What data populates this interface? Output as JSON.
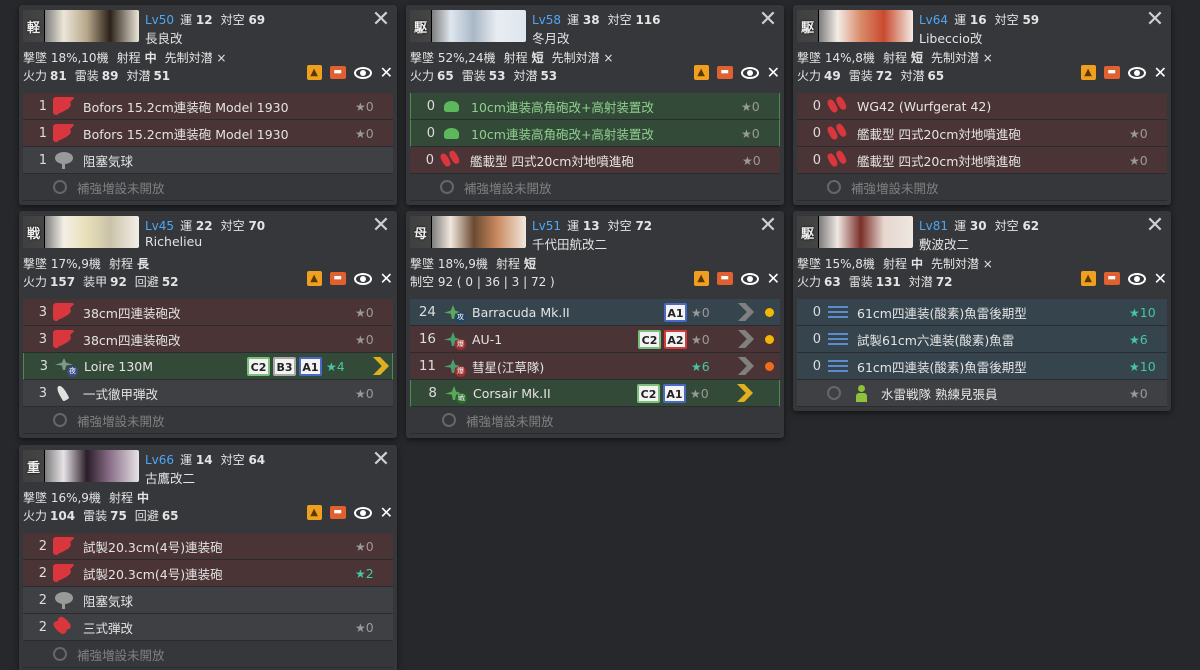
{
  "ships": [
    {
      "type_char": "軽",
      "level": "Lv50",
      "luck_label": "運",
      "luck": "12",
      "aa_label": "対空",
      "aa": "69",
      "name": "長良改",
      "shootdown": "撃墜 18%,10機",
      "range_label": "射程",
      "range": "中",
      "extra": "先制対潜 ×",
      "stats": [
        {
          "label": "火力",
          "value": "81"
        },
        {
          "label": "雷装",
          "value": "89"
        },
        {
          "label": "対潜",
          "value": "51"
        }
      ],
      "banner_colors": [
        "#ece6d8",
        "#b7a78a",
        "#2b2118"
      ],
      "equipment": [
        {
          "slot": "1",
          "icon": "gun-red",
          "name": "Bofors 15.2cm連装砲 Model 1930",
          "star": "0",
          "bg": "red"
        },
        {
          "slot": "1",
          "icon": "gun-red",
          "name": "Bofors 15.2cm連装砲 Model 1930",
          "star": "0",
          "bg": "red"
        },
        {
          "slot": "1",
          "icon": "balloon-gray",
          "name": "阻塞気球",
          "star": "",
          "bg": "gray"
        },
        {
          "slot": "",
          "icon": "slot-locked",
          "name": "補強増設未開放",
          "star": "",
          "bg": "none"
        }
      ]
    },
    {
      "type_char": "駆",
      "level": "Lv58",
      "luck_label": "運",
      "luck": "38",
      "aa_label": "対空",
      "aa": "116",
      "name": "冬月改",
      "shootdown": "撃墜 52%,24機",
      "range_label": "射程",
      "range": "短",
      "extra": "先制対潜 ×",
      "stats": [
        {
          "label": "火力",
          "value": "65"
        },
        {
          "label": "雷装",
          "value": "53"
        },
        {
          "label": "対潜",
          "value": "53"
        }
      ],
      "banner_colors": [
        "#dfe6ee",
        "#a9b7c6",
        "#e9edf2"
      ],
      "equipment": [
        {
          "slot": "0",
          "icon": "gun-green",
          "name": "10cm連装高角砲改+高射装置改",
          "star": "0",
          "bg": "green"
        },
        {
          "slot": "0",
          "icon": "gun-green",
          "name": "10cm連装高角砲改+高射装置改",
          "star": "0",
          "bg": "green"
        },
        {
          "slot": "0",
          "icon": "rocket-red",
          "name": "艦載型 四式20cm対地噴進砲",
          "star": "0",
          "bg": "red"
        },
        {
          "slot": "",
          "icon": "slot-locked",
          "name": "補強増設未開放",
          "star": "",
          "bg": "none"
        }
      ]
    },
    {
      "type_char": "駆",
      "level": "Lv64",
      "luck_label": "運",
      "luck": "16",
      "aa_label": "対空",
      "aa": "59",
      "name": "Libeccio改",
      "shootdown": "撃墜 14%,8機",
      "range_label": "射程",
      "range": "短",
      "extra": "先制対潜 ×",
      "stats": [
        {
          "label": "火力",
          "value": "49"
        },
        {
          "label": "雷装",
          "value": "72"
        },
        {
          "label": "対潜",
          "value": "65"
        }
      ],
      "banner_colors": [
        "#f3ece6",
        "#d98a6a",
        "#c94a2e"
      ],
      "equipment": [
        {
          "slot": "0",
          "icon": "rocket-red",
          "name": "WG42 (Wurfgerat 42)",
          "star": "",
          "bg": "red"
        },
        {
          "slot": "0",
          "icon": "rocket-red",
          "name": "艦載型 四式20cm対地噴進砲",
          "star": "0",
          "bg": "red"
        },
        {
          "slot": "0",
          "icon": "rocket-red",
          "name": "艦載型 四式20cm対地噴進砲",
          "star": "0",
          "bg": "red"
        },
        {
          "slot": "",
          "icon": "slot-locked",
          "name": "補強増設未開放",
          "star": "",
          "bg": "none"
        }
      ]
    },
    {
      "type_char": "戦",
      "level": "Lv45",
      "luck_label": "運",
      "luck": "22",
      "aa_label": "対空",
      "aa": "70",
      "name": "Richelieu",
      "shootdown": "撃墜 17%,9機",
      "range_label": "射程",
      "range": "長",
      "extra": "",
      "stats": [
        {
          "label": "火力",
          "value": "157"
        },
        {
          "label": "装甲",
          "value": "92"
        },
        {
          "label": "回避",
          "value": "52"
        }
      ],
      "banner_colors": [
        "#f3efe6",
        "#e8dfb8",
        "#c9c2a9"
      ],
      "equipment": [
        {
          "slot": "3",
          "icon": "gun-red",
          "name": "38cm四連装砲改",
          "star": "0",
          "bg": "red"
        },
        {
          "slot": "3",
          "icon": "gun-red",
          "name": "38cm四連装砲改",
          "star": "0",
          "bg": "red"
        },
        {
          "slot": "3",
          "icon": "seaplane",
          "name": "Loire 130M",
          "star": "4",
          "bg": "green",
          "chips": [
            "C2",
            "B3",
            "A1"
          ],
          "chevron": "gold"
        },
        {
          "slot": "3",
          "icon": "shell-white",
          "name": "一式徹甲弾改",
          "star": "0",
          "bg": "gray"
        },
        {
          "slot": "",
          "icon": "slot-locked",
          "name": "補強増設未開放",
          "star": "",
          "bg": "none"
        }
      ]
    },
    {
      "type_char": "母",
      "level": "Lv51",
      "luck_label": "運",
      "luck": "13",
      "aa_label": "対空",
      "aa": "72",
      "name": "千代田航改二",
      "shootdown": "撃墜 18%,9機",
      "range_label": "射程",
      "range": "短",
      "extra": "",
      "fighter_power": "制空 92 ( 0 | 36 | 3 | 72 )",
      "stats": [],
      "banner_colors": [
        "#f1e8de",
        "#6b4a32",
        "#c98a5e"
      ],
      "equipment": [
        {
          "slot": "24",
          "icon": "plane-torp",
          "name": "Barracuda Mk.II",
          "star": "0",
          "bg": "blue",
          "chips": [
            "A1"
          ],
          "chevron": "silver",
          "dot": "y"
        },
        {
          "slot": "16",
          "icon": "plane-bomb",
          "name": "AU-1",
          "star": "0",
          "bg": "red",
          "chips": [
            "C2",
            "A2"
          ],
          "chevron": "silver",
          "dot": "y"
        },
        {
          "slot": "11",
          "icon": "plane-bomb",
          "name": "彗星(江草隊)",
          "star": "6",
          "bg": "red",
          "chips": [],
          "chevron": "silver",
          "dot": "o"
        },
        {
          "slot": "8",
          "icon": "plane-fight",
          "name": "Corsair Mk.II",
          "star": "0",
          "bg": "green",
          "chips": [
            "C2",
            "A1"
          ],
          "chevron": "gold",
          "dot": "none"
        },
        {
          "slot": "",
          "icon": "slot-locked",
          "name": "補強増設未開放",
          "star": "",
          "bg": "none"
        }
      ]
    },
    {
      "type_char": "駆",
      "level": "Lv81",
      "luck_label": "運",
      "luck": "30",
      "aa_label": "対空",
      "aa": "62",
      "name": "敷波改二",
      "shootdown": "撃墜 15%,8機",
      "range_label": "射程",
      "range": "中",
      "extra": "先制対潜 ×",
      "stats": [
        {
          "label": "火力",
          "value": "63"
        },
        {
          "label": "雷装",
          "value": "131"
        },
        {
          "label": "対潜",
          "value": "72"
        }
      ],
      "banner_colors": [
        "#efe7e2",
        "#7a2f2a",
        "#e6d7cf"
      ],
      "equipment": [
        {
          "slot": "0",
          "icon": "torpedo",
          "name": "61cm四連装(酸素)魚雷後期型",
          "star": "10",
          "bg": "blue"
        },
        {
          "slot": "0",
          "icon": "torpedo",
          "name": "試製61cm六連装(酸素)魚雷",
          "star": "6",
          "bg": "blue"
        },
        {
          "slot": "0",
          "icon": "torpedo",
          "name": "61cm四連装(酸素)魚雷後期型",
          "star": "10",
          "bg": "blue"
        },
        {
          "slot": "",
          "icon": "personnel",
          "name": "水雷戦隊 熟練見張員",
          "star": "0",
          "bg": "gray",
          "slot_ring": true
        }
      ]
    },
    {
      "type_char": "重",
      "level": "Lv66",
      "luck_label": "運",
      "luck": "14",
      "aa_label": "対空",
      "aa": "64",
      "name": "古鷹改二",
      "shootdown": "撃墜 16%,9機",
      "range_label": "射程",
      "range": "中",
      "extra": "",
      "stats": [
        {
          "label": "火力",
          "value": "104"
        },
        {
          "label": "雷装",
          "value": "75"
        },
        {
          "label": "回避",
          "value": "65"
        }
      ],
      "banner_colors": [
        "#e7e3e6",
        "#2a1d28",
        "#8a6f88"
      ],
      "equipment": [
        {
          "slot": "2",
          "icon": "gun-red",
          "name": "試製20.3cm(4号)連装砲",
          "star": "0",
          "bg": "red"
        },
        {
          "slot": "2",
          "icon": "gun-red",
          "name": "試製20.3cm(4号)連装砲",
          "star": "2",
          "bg": "red"
        },
        {
          "slot": "2",
          "icon": "balloon-gray",
          "name": "阻塞気球",
          "star": "",
          "bg": "gray"
        },
        {
          "slot": "2",
          "icon": "shell-red",
          "name": "三式弾改",
          "star": "0",
          "bg": "gray"
        },
        {
          "slot": "",
          "icon": "slot-locked",
          "name": "補強増設未開放",
          "star": "",
          "bg": "none"
        }
      ]
    }
  ],
  "star_symbol": "★",
  "close_symbol": "✕"
}
